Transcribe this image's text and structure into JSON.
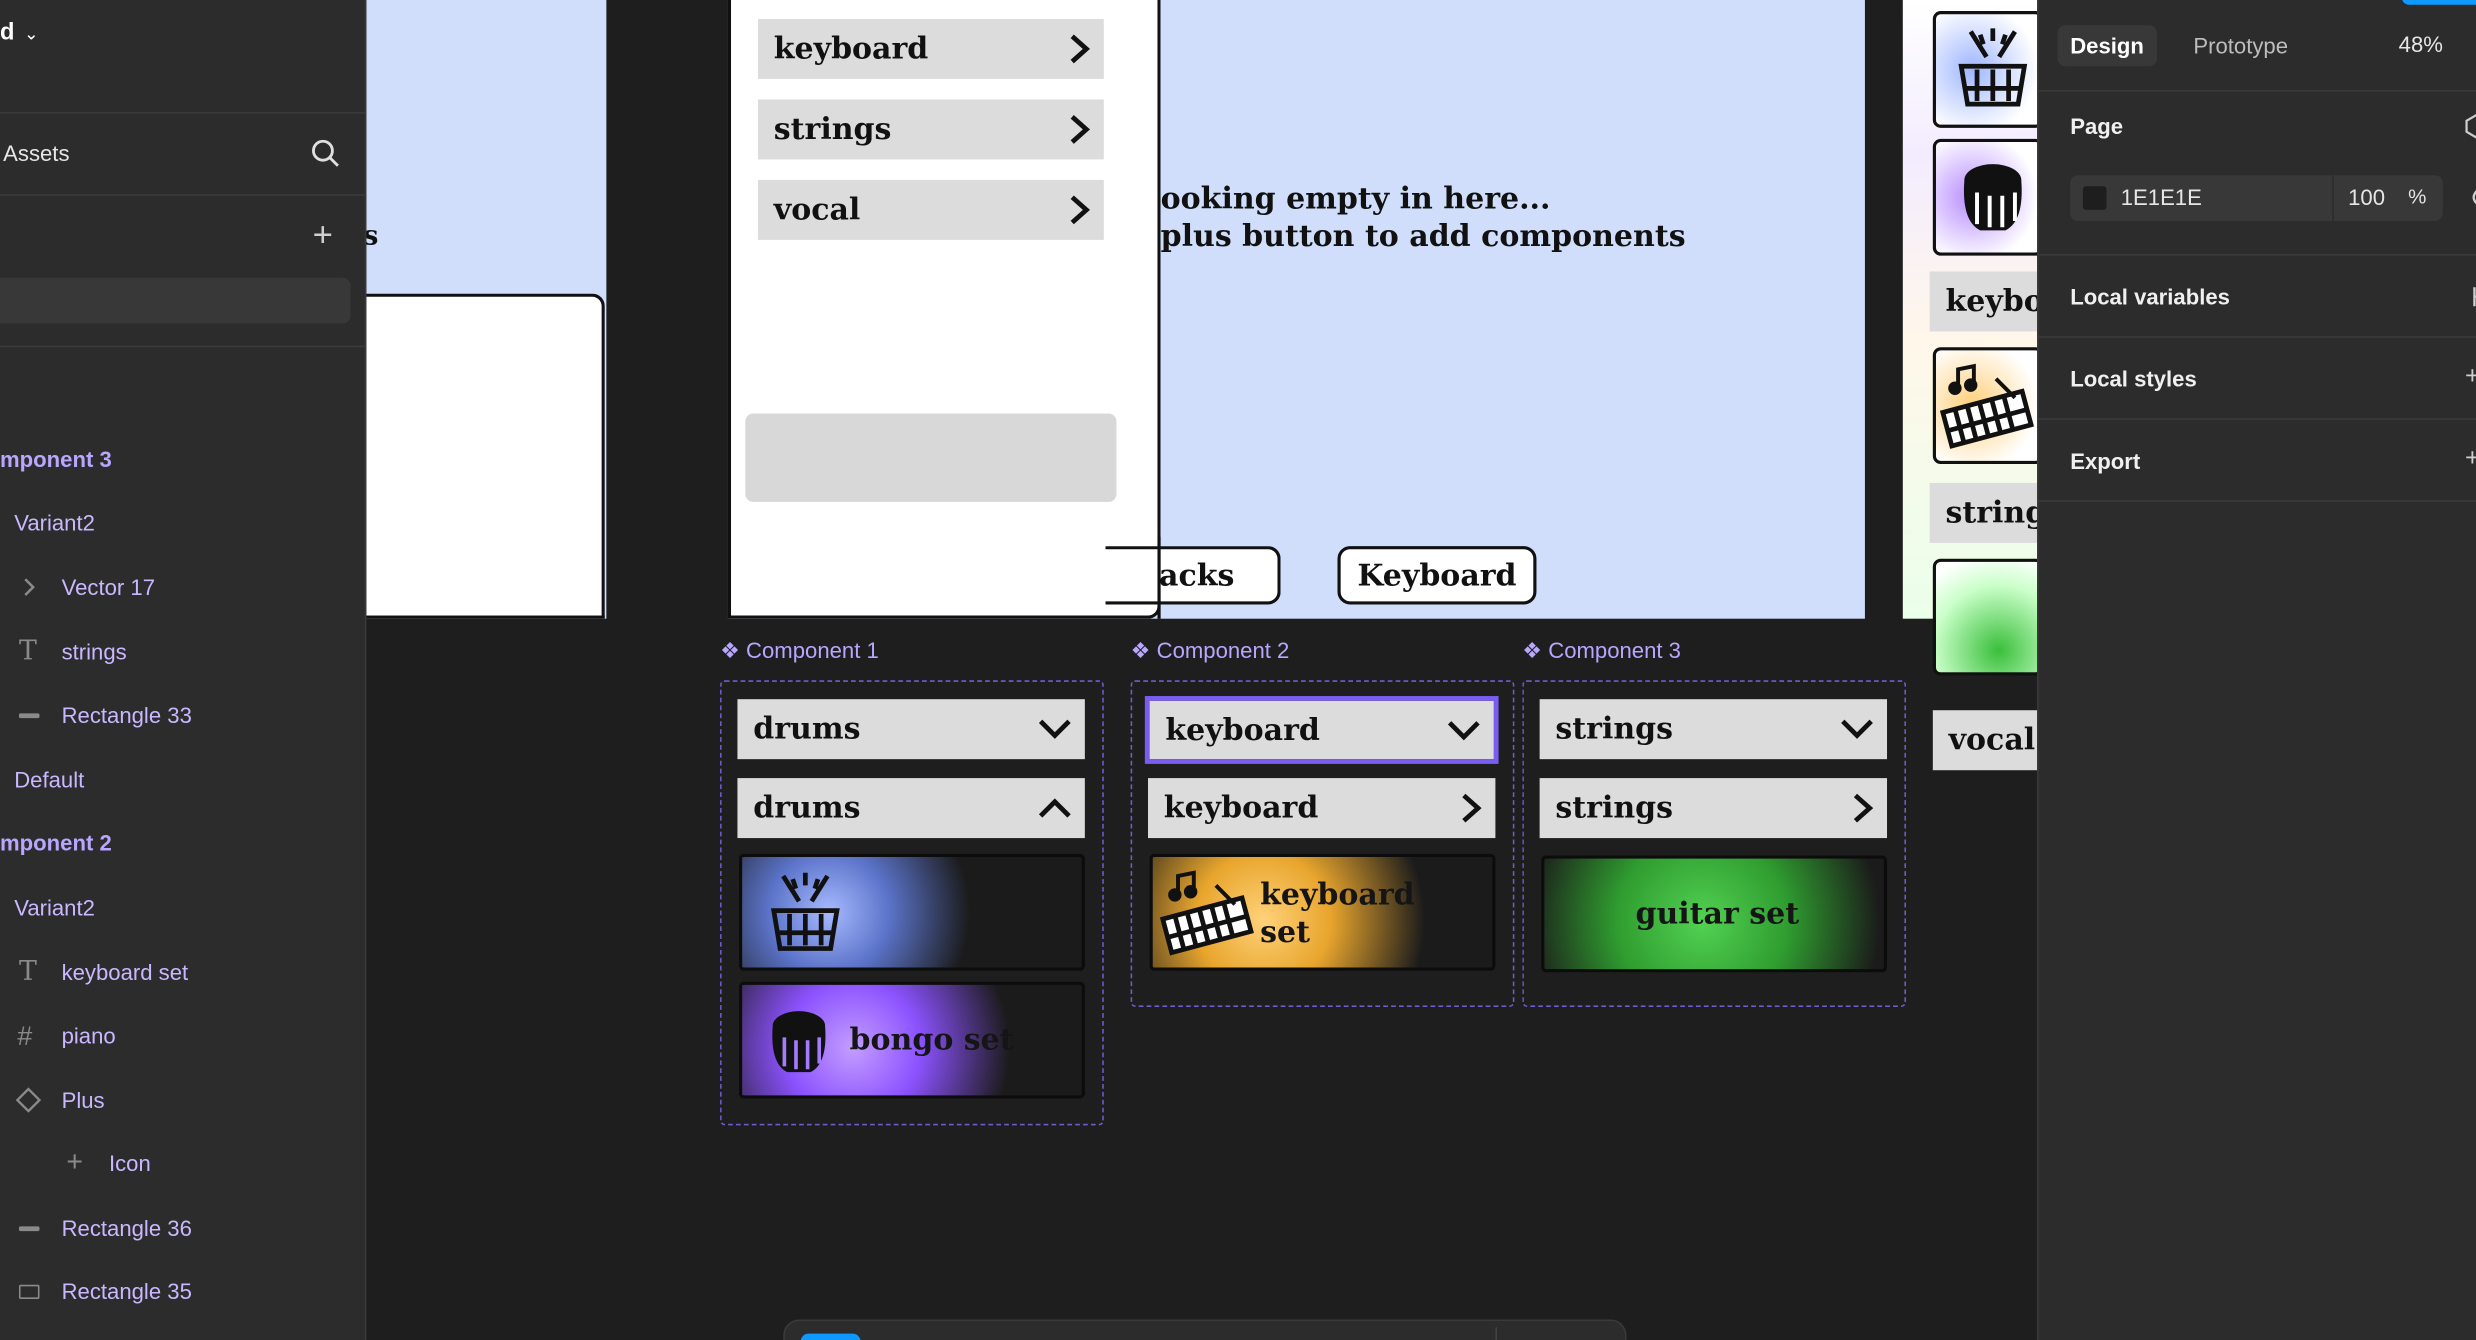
{
  "app": {
    "file_initial": "d",
    "zoom": "48%"
  },
  "left_panel": {
    "assets_tab": "Assets",
    "layers": [
      {
        "label": "mponent 3",
        "kind": "component"
      },
      {
        "label": "Variant2",
        "kind": "variant"
      },
      {
        "label": "Vector 17",
        "kind": "vector"
      },
      {
        "label": "strings",
        "kind": "text"
      },
      {
        "label": "Rectangle 33",
        "kind": "line"
      },
      {
        "label": "Default",
        "kind": "variant"
      },
      {
        "label": "mponent 2",
        "kind": "component"
      },
      {
        "label": "Variant2",
        "kind": "variant"
      },
      {
        "label": "keyboard set",
        "kind": "text"
      },
      {
        "label": "piano",
        "kind": "frame"
      },
      {
        "label": "Plus",
        "kind": "instance"
      },
      {
        "label": "Icon",
        "kind": "plus"
      },
      {
        "label": "Rectangle 36",
        "kind": "line"
      },
      {
        "label": "Rectangle 35",
        "kind": "rect"
      }
    ],
    "partial_canvas_letter": "s"
  },
  "canvas": {
    "menu_items": [
      "keyboard",
      "strings",
      "vocal"
    ],
    "empty_message_line1": "ooking empty in here...",
    "empty_message_line2": "plus button to add components",
    "pill_left": "acks",
    "pill_right": "Keyboard",
    "component1": {
      "label": "Component 1",
      "closed_label": "drums",
      "open_label": "drums",
      "bongo_label": "bongo set"
    },
    "component2": {
      "label": "Component 2",
      "closed_label": "keyboard",
      "open_label": "keyboard",
      "set_label": "keyboard set"
    },
    "component3": {
      "label": "Component 3",
      "closed_label": "strings",
      "open_label": "strings",
      "set_label": "guitar set"
    },
    "right_frame": {
      "keyboard_partial": "keybo",
      "strings_partial": "string",
      "vocal": "vocal"
    }
  },
  "right_panel": {
    "tabs": [
      "Design",
      "Prototype"
    ],
    "page_heading": "Page",
    "page_color_hex": "1E1E1E",
    "page_opacity": "100",
    "percent": "%",
    "sections": [
      "Local variables",
      "Local styles",
      "Export"
    ]
  },
  "colors": {
    "accent_purple": "#7b5cf0",
    "canvas_bg": "#1e1e1e",
    "frame_blue": "#d0defb",
    "button_gray": "#dcdcdc"
  }
}
